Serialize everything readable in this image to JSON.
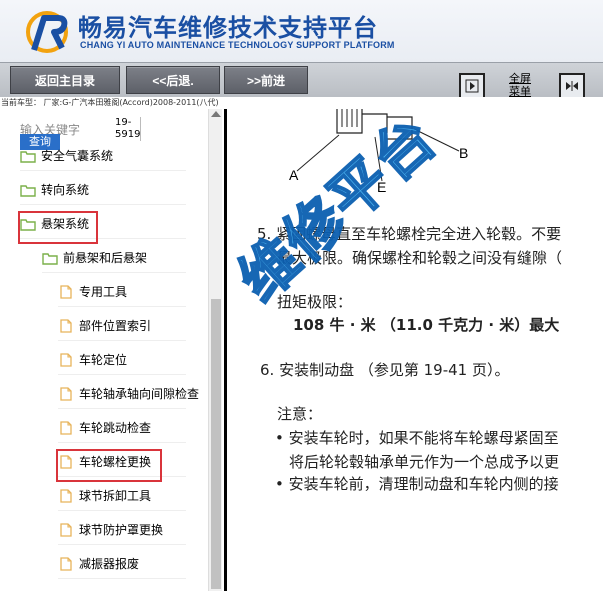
{
  "header": {
    "title_cn": "畅易汽车维修技术支持平台",
    "title_en": "CHANG YI AUTO MAINTENANCE TECHNOLOGY SUPPORT PLATFORM"
  },
  "toolbar": {
    "home_label": "返回主目录",
    "back_label": "<<后退.",
    "forward_label": ">>前进",
    "fullscreen_line1": "全屏",
    "fullscreen_line2": "菜单"
  },
  "vehicle_info": "当前车型：  厂家:G-广汽本田雅阁(Accord)2008-2011(八代)",
  "sidebar": {
    "keyword_placeholder": "输入关键字",
    "keyword_ref_line1": "19-",
    "keyword_ref_line2": "5919",
    "query_label": "查询",
    "items": [
      {
        "label": "安全气囊系统",
        "type": "folder",
        "level": 0
      },
      {
        "label": "转向系统",
        "type": "folder",
        "level": 0
      },
      {
        "label": "悬架系统",
        "type": "folder",
        "level": 0,
        "highlighted": true
      },
      {
        "label": "前悬架和后悬架",
        "type": "folder",
        "level": 1
      },
      {
        "label": "专用工具",
        "type": "doc",
        "level": 2
      },
      {
        "label": "部件位置索引",
        "type": "doc",
        "level": 2
      },
      {
        "label": "车轮定位",
        "type": "doc",
        "level": 2
      },
      {
        "label": "车轮轴承轴向间隙检查",
        "type": "doc",
        "level": 2
      },
      {
        "label": "车轮跳动检查",
        "type": "doc",
        "level": 2
      },
      {
        "label": "车轮螺栓更换",
        "type": "doc",
        "level": 2,
        "highlighted": true
      },
      {
        "label": "球节拆卸工具",
        "type": "doc",
        "level": 2
      },
      {
        "label": "球节防护罩更换",
        "type": "doc",
        "level": 2
      },
      {
        "label": "减振器报废",
        "type": "doc",
        "level": 2
      }
    ]
  },
  "document": {
    "watermark": "维修平台",
    "label_a": "A",
    "label_b": "B",
    "label_e": "E",
    "step5_line1": "5. 紧固螺母直至车轮螺栓完全进入轮毂。不要",
    "step5_line2": "最大极限。确保螺栓和轮毂之间没有缝隙（",
    "torque_title": "扭矩极限：",
    "torque_value": "108 牛 · 米 （11.0 千克力 · 米）最大",
    "step6": "6. 安装制动盘 （参见第 19-41 页）。",
    "note_title": "注意：",
    "note1_line1": "• 安装车轮时，如果不能将车轮螺母紧固至",
    "note1_line2": "将后轮轮毂轴承单元作为一个总成予以更",
    "note2": "• 安装车轮前，清理制动盘和车轮内侧的接"
  },
  "colors": {
    "brand_blue": "#1a4fa3",
    "highlight_red": "#d9343b",
    "watermark_blue": "#45b3f3"
  }
}
